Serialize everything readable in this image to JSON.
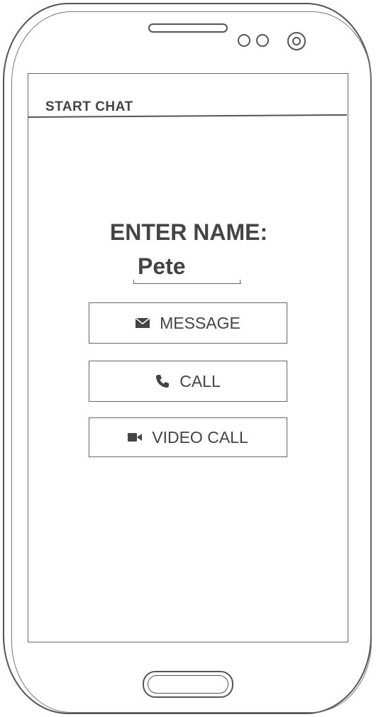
{
  "header": {
    "title": "START CHAT"
  },
  "form": {
    "label": "ENTER NAME:",
    "name_value": "Pete"
  },
  "actions": {
    "message": {
      "label": "MESSAGE",
      "icon": "envelope-icon"
    },
    "call": {
      "label": "CALL",
      "icon": "phone-icon"
    },
    "video_call": {
      "label": "VIDEO CALL",
      "icon": "video-camera-icon"
    }
  }
}
